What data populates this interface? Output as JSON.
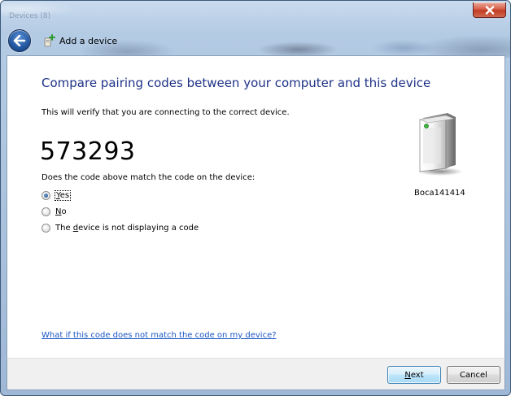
{
  "window": {
    "background_title": "Devices (8)"
  },
  "header": {
    "title": "Add a device"
  },
  "content": {
    "main_instruction": "Compare pairing codes between your computer and this device",
    "intro": "This will verify that you are connecting to the correct device.",
    "pairing_code": "573293",
    "question": "Does the code above match the code on the device:",
    "options": [
      {
        "pre": "",
        "accel": "Y",
        "post": "es",
        "selected": true
      },
      {
        "pre": "",
        "accel": "N",
        "post": "o",
        "selected": false
      },
      {
        "pre": "The ",
        "accel": "d",
        "post": "evice is not displaying a code",
        "selected": false
      }
    ],
    "device_name": "Boca141414",
    "help_link": "What if this code does not match the code on my device?"
  },
  "footer": {
    "next": {
      "accel": "N",
      "post": "ext"
    },
    "cancel": "Cancel"
  },
  "colors": {
    "instruction_blue": "#1e3287",
    "link_blue": "#1a56c4",
    "close_red": "#c13c24"
  },
  "icons": {
    "back": "back-arrow-icon",
    "wizard": "add-device-icon",
    "close": "close-icon",
    "device": "printer-device-icon"
  }
}
